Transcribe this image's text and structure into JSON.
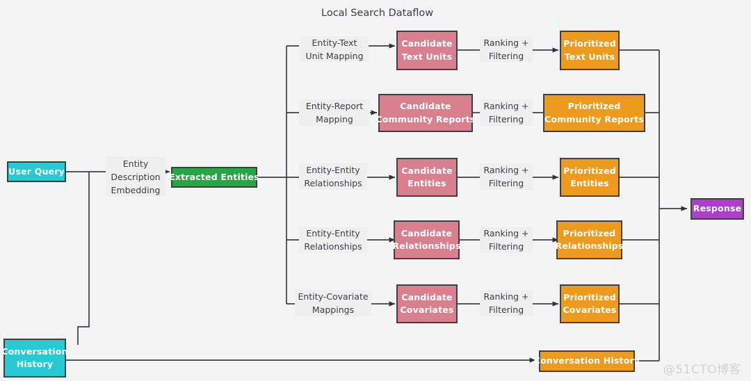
{
  "title": "Local Search Dataflow",
  "watermark": "@51CTO博客",
  "colors": {
    "background": "#f4f4f4",
    "stroke": "#3c3f44",
    "cyan": "#26cad3",
    "green": "#26a744",
    "rose": "#d9808f",
    "orange": "#ed9b1f",
    "purple": "#ad3ec9",
    "label_text": "#3a3d42"
  },
  "nodes": {
    "user_query": {
      "line1": "User Query"
    },
    "conversation_history_input": {
      "line1": "Conversation",
      "line2": "History"
    },
    "extracted_entities": {
      "line1": "Extracted Entities"
    },
    "candidate_text_units": {
      "line1": "Candidate",
      "line2": "Text Units"
    },
    "candidate_community_reports": {
      "line1": "Candidate",
      "line2": "Community Reports"
    },
    "candidate_entities": {
      "line1": "Candidate",
      "line2": "Entities"
    },
    "candidate_relationships": {
      "line1": "Candidate",
      "line2": "Relationships"
    },
    "candidate_covariates": {
      "line1": "Candidate",
      "line2": "Covariates"
    },
    "prioritized_text_units": {
      "line1": "Prioritized",
      "line2": "Text Units"
    },
    "prioritized_community_reports": {
      "line1": "Prioritized",
      "line2": "Community Reports"
    },
    "prioritized_entities": {
      "line1": "Prioritized",
      "line2": "Entities"
    },
    "prioritized_relationships": {
      "line1": "Prioritized",
      "line2": "Relationships"
    },
    "prioritized_covariates": {
      "line1": "Prioritized",
      "line2": "Covariates"
    },
    "conversation_history_output": {
      "line1": "Conversation History"
    },
    "response": {
      "line1": "Response"
    }
  },
  "edge_labels": {
    "entity_description_embedding": {
      "line1": "Entity",
      "line2": "Description",
      "line3": "Embedding"
    },
    "entity_text_unit_mapping": {
      "line1": "Entity-Text",
      "line2": "Unit Mapping"
    },
    "entity_report_mapping": {
      "line1": "Entity-Report",
      "line2": "Mapping"
    },
    "entity_entity_relationships_1": {
      "line1": "Entity-Entity",
      "line2": "Relationships"
    },
    "entity_entity_relationships_2": {
      "line1": "Entity-Entity",
      "line2": "Relationships"
    },
    "entity_covariate_mappings": {
      "line1": "Entity-Covariate",
      "line2": "Mappings"
    },
    "ranking_filtering_1": {
      "line1": "Ranking +",
      "line2": "Filtering"
    },
    "ranking_filtering_2": {
      "line1": "Ranking +",
      "line2": "Filtering"
    },
    "ranking_filtering_3": {
      "line1": "Ranking +",
      "line2": "Filtering"
    },
    "ranking_filtering_4": {
      "line1": "Ranking +",
      "line2": "Filtering"
    },
    "ranking_filtering_5": {
      "line1": "Ranking +",
      "line2": "Filtering"
    }
  }
}
